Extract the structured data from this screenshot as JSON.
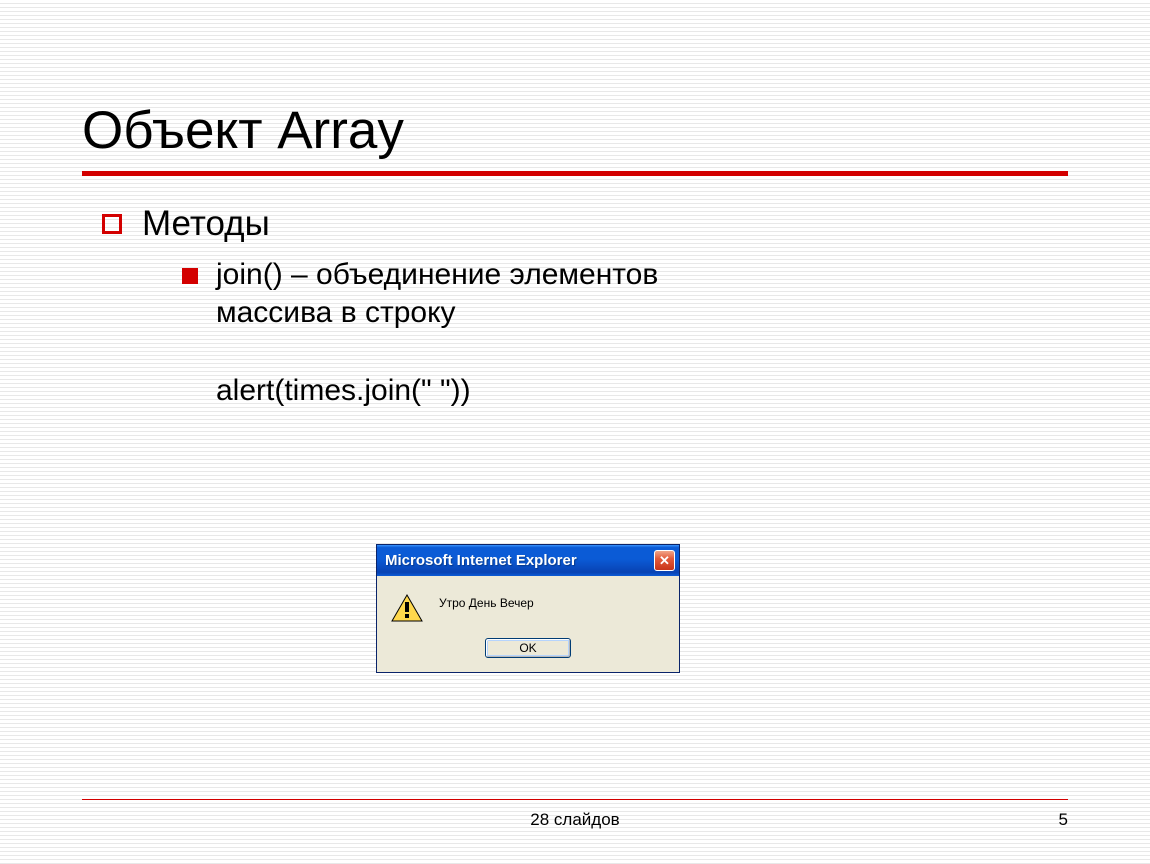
{
  "title": "Объект Array",
  "bullet": {
    "label": "Методы"
  },
  "subbullet": {
    "line1": "join() – объединение элементов",
    "line2": "массива в строку"
  },
  "code": "alert(times.join(\" \"))",
  "dialog": {
    "title": "Microsoft Internet Explorer",
    "message": "Утро День Вечер",
    "ok_label": "OK"
  },
  "footer": {
    "center": "28 слайдов",
    "page": "5"
  }
}
